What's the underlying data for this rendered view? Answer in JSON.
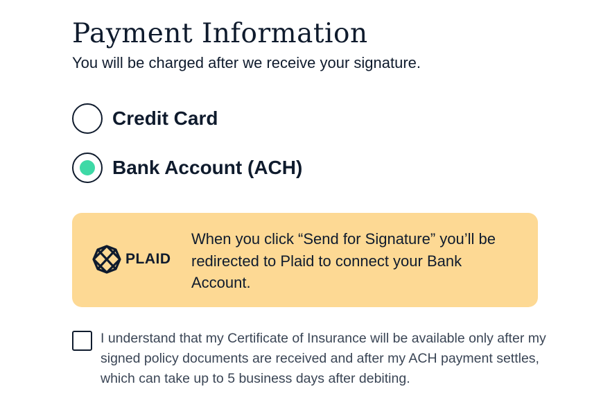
{
  "header": {
    "title": "Payment Information",
    "subtitle": "You will be charged after we receive your signature."
  },
  "payment_options": [
    {
      "label": "Credit Card",
      "selected": false
    },
    {
      "label": "Bank Account (ACH)",
      "selected": true
    }
  ],
  "info_box": {
    "logo_icon": "plaid-icon",
    "logo_text": "PLAID",
    "message": "When you click “Send for Signature” you’ll be redirected to Plaid to connect your Bank Account."
  },
  "acknowledgement": {
    "checked": false,
    "text": "I understand that my Certificate of Insurance will be available only after my signed policy documents are received and after my ACH payment settles, which can take up to 5 business days after debiting."
  },
  "colors": {
    "text_primary": "#0f1b2d",
    "text_secondary": "#3a4555",
    "radio_selected": "#3ed9a6",
    "info_box_bg": "#fdd994"
  }
}
